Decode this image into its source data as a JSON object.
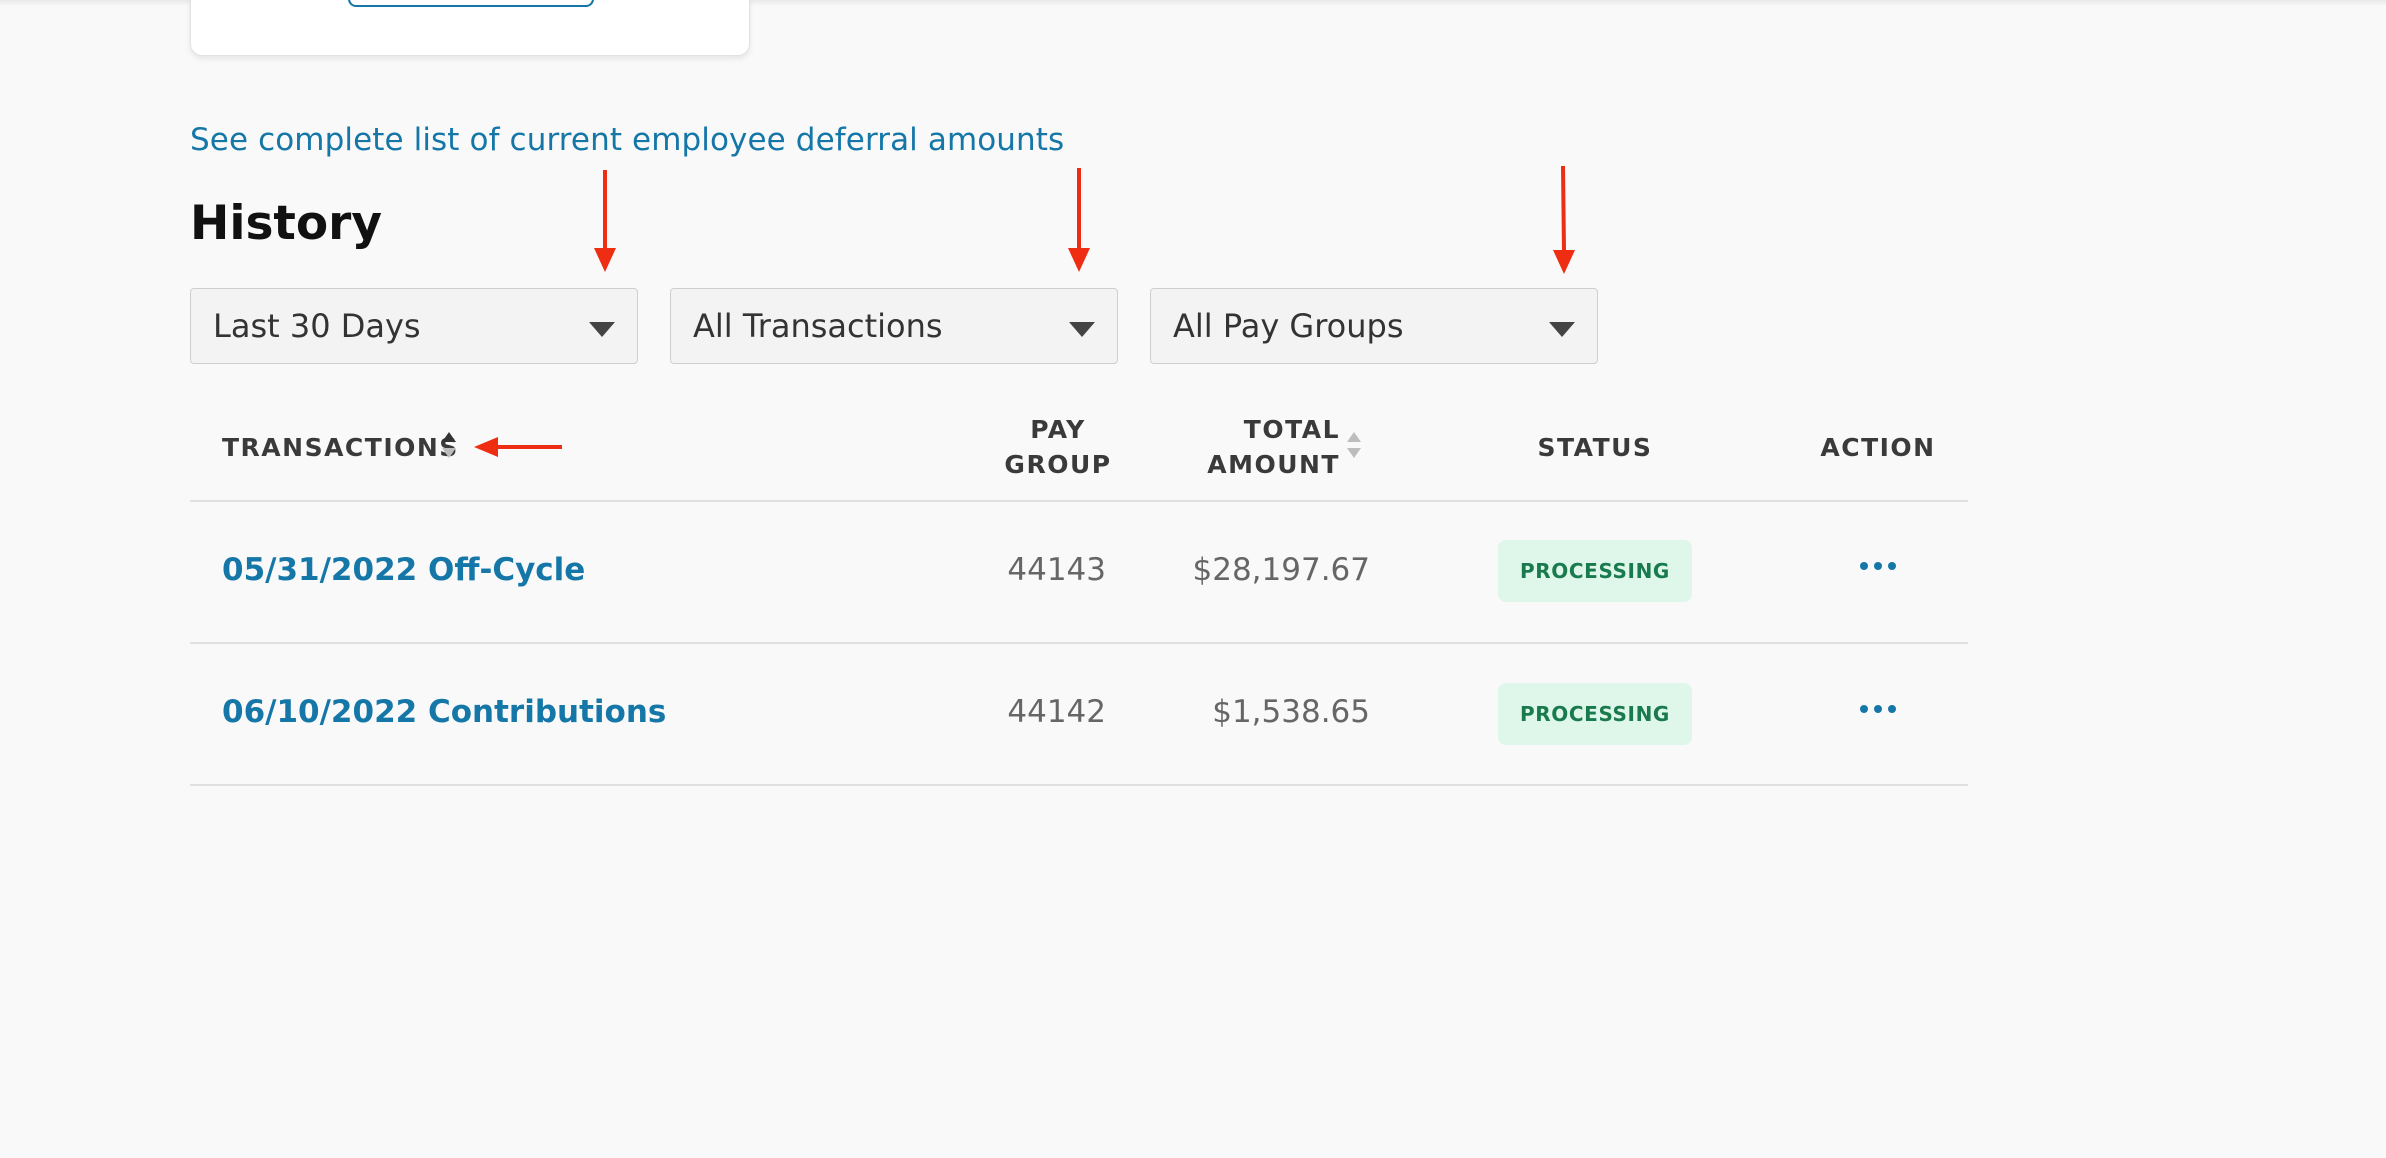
{
  "deferral_link": "See complete list of current employee deferral amounts",
  "history_title": "History",
  "filters": {
    "date_range": "Last 30 Days",
    "transaction_type": "All Transactions",
    "pay_group": "All Pay Groups"
  },
  "table": {
    "headers": {
      "transactions": "TRANSACTIONS",
      "pay_group_line1": "PAY",
      "pay_group_line2": "GROUP",
      "total_amount_line1": "TOTAL",
      "total_amount_line2": "AMOUNT",
      "status": "STATUS",
      "action": "ACTION"
    },
    "rows": [
      {
        "transaction": "05/31/2022 Off-Cycle",
        "pay_group": "44143",
        "total_amount": "$28,197.67",
        "status": "PROCESSING"
      },
      {
        "transaction": "06/10/2022 Contributions",
        "pay_group": "44142",
        "total_amount": "$1,538.65",
        "status": "PROCESSING"
      }
    ]
  },
  "colors": {
    "link": "#1577a8",
    "status_bg": "#dff6ea",
    "status_text": "#187a4d",
    "annotation_arrow": "#ee2d12"
  },
  "icons": {
    "filter_caret": "chevron-down-icon",
    "sort": "sort-icon",
    "row_actions": "more-horizontal-icon",
    "annotation": "red-arrow-annotation"
  }
}
